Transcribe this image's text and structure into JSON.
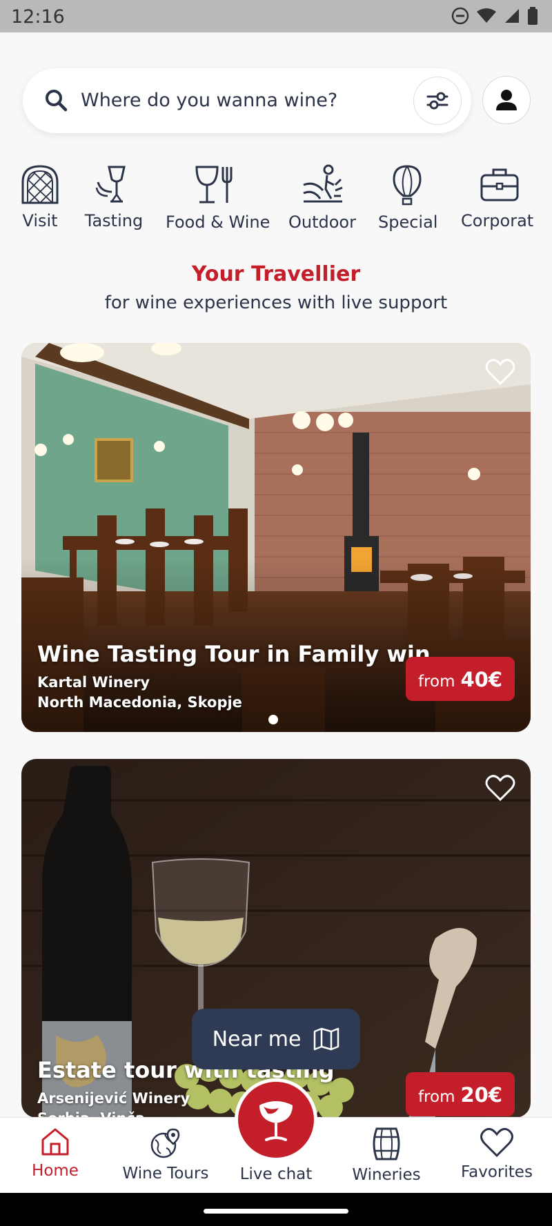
{
  "status_bar": {
    "time": "12:16"
  },
  "search": {
    "placeholder": "Where do you wanna wine?"
  },
  "categories": [
    {
      "label": "Visit",
      "icon": "arch-window-icon"
    },
    {
      "label": "Tasting",
      "icon": "wine-chair-icon"
    },
    {
      "label": "Food & Wine",
      "icon": "glass-fork-icon"
    },
    {
      "label": "Outdoor",
      "icon": "outdoor-icon"
    },
    {
      "label": "Special",
      "icon": "balloon-icon"
    },
    {
      "label": "Corporat",
      "icon": "briefcase-icon"
    }
  ],
  "headline": {
    "title": "Your Travellier",
    "subtitle": "for wine experiences with live support"
  },
  "cards": [
    {
      "title": "Wine Tasting Tour in Family win...",
      "winery": "Kartal Winery",
      "location": "North Macedonia, Skopje",
      "price_prefix": "from",
      "price": "40€"
    },
    {
      "title": "Estate tour with tasting",
      "winery": "Arsenijević Winery",
      "location": "Serbia, Vinča",
      "price_prefix": "from",
      "price": "20€"
    }
  ],
  "near_me": {
    "label": "Near me"
  },
  "bottom_nav": [
    {
      "label": "Home",
      "active": true
    },
    {
      "label": "Wine Tours",
      "active": false
    },
    {
      "label": "Live chat",
      "active": false
    },
    {
      "label": "Wineries",
      "active": false
    },
    {
      "label": "Favorites",
      "active": false
    }
  ],
  "colors": {
    "accent": "#c41e2a",
    "navy": "#2f3a55",
    "text": "#2b3348"
  }
}
